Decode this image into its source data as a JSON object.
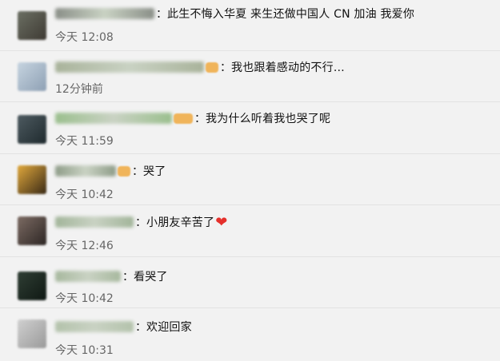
{
  "comments": [
    {
      "text": "此生不悔入华夏 来生还做中国人 CN 加油 我爱你",
      "time": "今天 12:08",
      "name_color": "#8a8f88",
      "avatar_colors": [
        "#6b6f63",
        "#3e3a33"
      ]
    },
    {
      "text": "我也跟着感动的不行…",
      "time": "12分钟前",
      "name_color": "#a9b39b",
      "avatar_colors": [
        "#c6d4e0",
        "#8ea0b4"
      ]
    },
    {
      "text": "我为什么听着我也哭了呢",
      "time": "今天 11:59",
      "name_color": "#9bbf8e",
      "avatar_colors": [
        "#4d5a60",
        "#1f2a2e"
      ]
    },
    {
      "text": "哭了",
      "time": "今天 10:42",
      "name_color": "#8e9c88",
      "avatar_colors": [
        "#e0a83c",
        "#3a2a16"
      ]
    },
    {
      "text": "小朋友辛苦了",
      "time": "今天 12:46",
      "name_color": "#a2b59a",
      "avatar_colors": [
        "#7c6b63",
        "#2d2624"
      ],
      "heart_icon": "red-heart-icon"
    },
    {
      "text": "看哭了",
      "time": "今天 10:42",
      "name_color": "#a7b89e",
      "avatar_colors": [
        "#2f3e34",
        "#0f1813"
      ]
    },
    {
      "text": "欢迎回家",
      "time": "今天 10:31",
      "name_color": "#b3c2ab",
      "avatar_colors": [
        "#d0d0d0",
        "#9a9a9a"
      ]
    }
  ]
}
